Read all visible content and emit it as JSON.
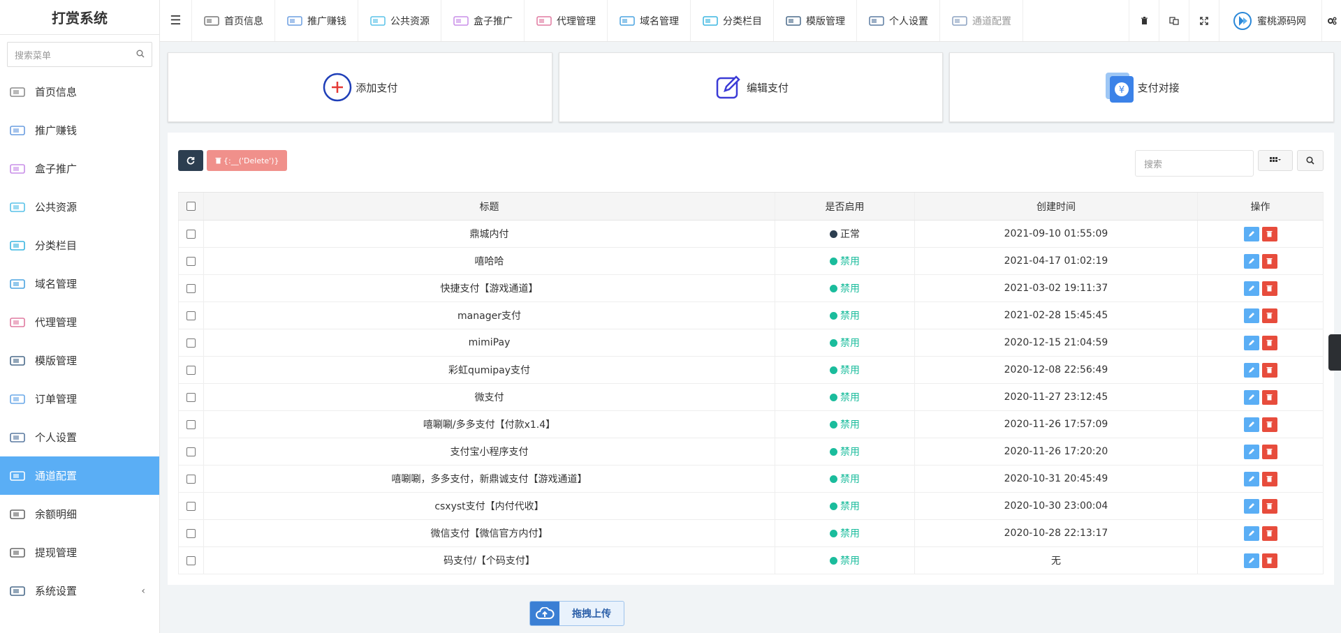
{
  "sidebar": {
    "brand": "打赏系统",
    "search_placeholder": "搜索菜单",
    "items": [
      {
        "label": "首页信息",
        "icon": "home-info-icon"
      },
      {
        "label": "推广赚钱",
        "icon": "promote-icon"
      },
      {
        "label": "盒子推广",
        "icon": "box-icon"
      },
      {
        "label": "公共资源",
        "icon": "resource-icon"
      },
      {
        "label": "分类栏目",
        "icon": "category-icon"
      },
      {
        "label": "域名管理",
        "icon": "domain-icon"
      },
      {
        "label": "代理管理",
        "icon": "agent-icon"
      },
      {
        "label": "模版管理",
        "icon": "template-icon"
      },
      {
        "label": "订单管理",
        "icon": "order-icon"
      },
      {
        "label": "个人设置",
        "icon": "profile-icon"
      },
      {
        "label": "通道配置",
        "icon": "channel-icon",
        "active": true
      },
      {
        "label": "余额明细",
        "icon": "balance-icon"
      },
      {
        "label": "提现管理",
        "icon": "withdraw-icon"
      },
      {
        "label": "系统设置",
        "icon": "system-icon",
        "chevron": "‹"
      }
    ]
  },
  "topbar": {
    "tabs": [
      {
        "label": "首页信息"
      },
      {
        "label": "推广赚钱"
      },
      {
        "label": "公共资源"
      },
      {
        "label": "盒子推广"
      },
      {
        "label": "代理管理"
      },
      {
        "label": "域名管理"
      },
      {
        "label": "分类栏目"
      },
      {
        "label": "模版管理"
      },
      {
        "label": "个人设置"
      },
      {
        "label": "通道配置"
      }
    ],
    "user": "蜜桃源码网"
  },
  "cards": [
    {
      "label": "添加支付",
      "icon": "add-circle-icon"
    },
    {
      "label": "编辑支付",
      "icon": "edit-icon"
    },
    {
      "label": "支付对接",
      "icon": "payment-connect-icon"
    }
  ],
  "toolbar": {
    "delete_label": "{:__('Delete')}",
    "search_placeholder": "搜索"
  },
  "table": {
    "headers": [
      "标题",
      "是否启用",
      "创建时间",
      "操作"
    ],
    "rows": [
      {
        "title": "鼎城内付",
        "status": "正常",
        "created": "2021-09-10 01:55:09",
        "state": "ok"
      },
      {
        "title": "嘻哈哈",
        "status": "禁用",
        "created": "2021-04-17 01:02:19",
        "state": "off"
      },
      {
        "title": "快捷支付【游戏通道】",
        "status": "禁用",
        "created": "2021-03-02 19:11:37",
        "state": "off"
      },
      {
        "title": "manager支付",
        "status": "禁用",
        "created": "2021-02-28 15:45:45",
        "state": "off"
      },
      {
        "title": "mimiPay",
        "status": "禁用",
        "created": "2020-12-15 21:04:59",
        "state": "off"
      },
      {
        "title": "彩虹qumipay支付",
        "status": "禁用",
        "created": "2020-12-08 22:56:49",
        "state": "off"
      },
      {
        "title": "微支付",
        "status": "禁用",
        "created": "2020-11-27 23:12:45",
        "state": "off"
      },
      {
        "title": "嘻唰唰/多多支付【付款x1.4】",
        "status": "禁用",
        "created": "2020-11-26 17:57:09",
        "state": "off"
      },
      {
        "title": "支付宝小程序支付",
        "status": "禁用",
        "created": "2020-11-26 17:20:20",
        "state": "off"
      },
      {
        "title": "嘻唰唰，多多支付，新鼎诚支付【游戏通道】",
        "status": "禁用",
        "created": "2020-10-31 20:45:49",
        "state": "off"
      },
      {
        "title": "csxyst支付【内付代收】",
        "status": "禁用",
        "created": "2020-10-30 23:00:04",
        "state": "off"
      },
      {
        "title": "微信支付【微信官方内付】",
        "status": "禁用",
        "created": "2020-10-28 22:13:17",
        "state": "off"
      },
      {
        "title": "码支付/【个码支付】",
        "status": "禁用",
        "created": "无",
        "state": "off"
      }
    ]
  },
  "upload": {
    "label": "拖拽上传"
  },
  "colors": {
    "accent": "#5aaef5",
    "dark": "#2c3e50",
    "danger": "#e74c3c",
    "success": "#1abc9c"
  }
}
